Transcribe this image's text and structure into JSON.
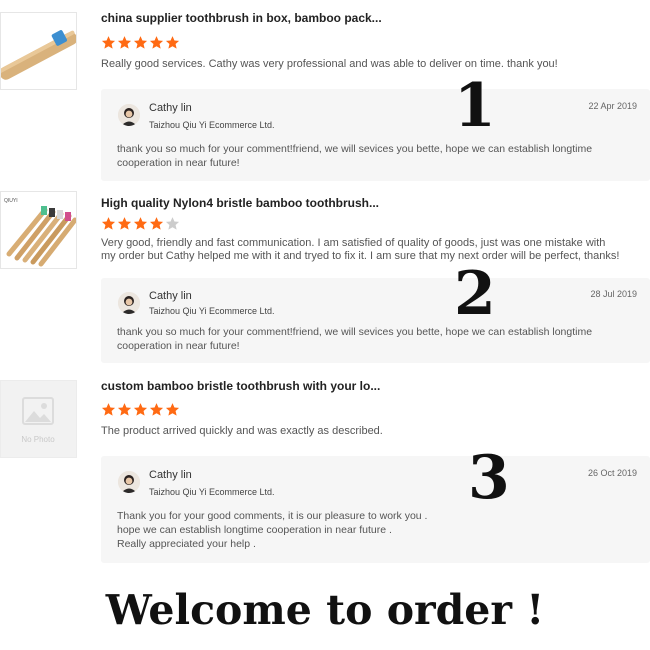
{
  "reviews": [
    {
      "product_title": "china supplier toothbrush in box, bamboo pack...",
      "rating": 5,
      "text": "Really good services. Cathy was very professional and was able to deliver on time. thank you!",
      "reply": {
        "seller_name": "Cathy lin",
        "company": "Taizhou Qiu Yi Ecommerce Ltd.",
        "date": "22 Apr 2019",
        "text": "thank you so much for your comment!friend, we will sevices you bette, hope we can establish longtime cooperation in near future!"
      },
      "overlay_number": "1"
    },
    {
      "product_title": "High quality Nylon4 bristle bamboo toothbrush...",
      "thumb_label": "QIUYI",
      "rating": 4,
      "text": "Very good, friendly and fast communication. I am satisfied of quality of goods, just was one mistake with my order but Cathy helped me with it and tryed to fix it. I am sure that my next order will be perfect, thanks!",
      "reply": {
        "seller_name": "Cathy lin",
        "company": "Taizhou Qiu Yi Ecommerce Ltd.",
        "date": "28 Jul 2019",
        "text": "thank you so much for your comment!friend, we will sevices you bette, hope we can establish longtime cooperation in near future!"
      },
      "overlay_number": "2"
    },
    {
      "product_title": "custom bamboo bristle toothbrush with your lo...",
      "thumb_label": "No Photo",
      "rating": 5,
      "text": "The product arrived quickly and was exactly as described.",
      "reply": {
        "seller_name": "Cathy lin",
        "company": "Taizhou Qiu Yi Ecommerce Ltd.",
        "date": "26 Oct 2019",
        "text": "Thank you for your good comments, it is our pleasure to work you .\nhope we can establish longtime cooperation in near future .\nReally appreciated your help ."
      },
      "overlay_number": "3"
    }
  ],
  "footer_text": "Welcome to order !",
  "colors": {
    "star_active": "#ff6a13",
    "star_inactive": "#cccccc",
    "reply_bg": "#f6f6f6"
  }
}
